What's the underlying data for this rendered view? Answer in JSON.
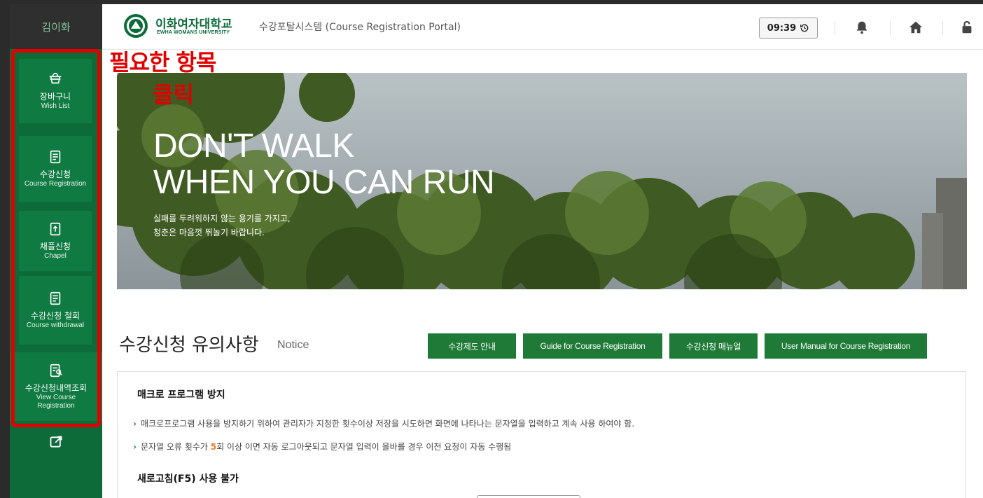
{
  "sidebar": {
    "user_name": "김이화",
    "items": [
      {
        "ko": "장바구니",
        "en": "Wish List",
        "icon": "basket-icon"
      },
      {
        "ko": "수강신청",
        "en": "Course Registration",
        "icon": "clipboard-icon"
      },
      {
        "ko": "채플신청",
        "en": "Chapel",
        "icon": "upload-doc-icon"
      },
      {
        "ko": "수강신청 철회",
        "en": "Course withdrawal",
        "icon": "clipboard-icon"
      },
      {
        "ko": "수강신청내역조회",
        "en": "View Course Registration",
        "icon": "search-doc-icon"
      }
    ],
    "external_icon": "external-link-icon"
  },
  "header": {
    "university_ko": "이화여자대학교",
    "university_en": "EWHA WOMANS UNIVERSITY",
    "portal_title": "수강포탈시스템 (Course Registration Portal)",
    "timer": "09:39",
    "icons": [
      "history-icon",
      "bell-icon",
      "home-icon",
      "lock-icon"
    ]
  },
  "annotation": {
    "line1": "필요한 항목",
    "line2": "클릭",
    "color": "#e00000"
  },
  "banner": {
    "headline_1": "DON'T WALK",
    "headline_2": "WHEN YOU CAN RUN",
    "subtext_1": "실패를 두려워하지 않는 용기를 가지고,",
    "subtext_2": "청춘은 마음껏 뛰놀기 바랍니다."
  },
  "notice": {
    "title": "수강신청 유의사항",
    "subtitle": "Notice",
    "buttons": [
      "수강제도 안내",
      "Guide for Course Registration",
      "수강신청 매뉴얼",
      "User Manual for Course Registration"
    ],
    "section_1_title": "매크로 프로그램 방지",
    "section_1_line_1": "매크로프로그램 사용을 방지하기 위하여 관리자가 지정한 횟수이상 저장을 시도하면 화면에 나타나는 문자열을 입력하고 계속 사용 하여야 함.",
    "section_1_line_2_pre": "문자열 오류 횟수가 ",
    "section_1_line_2_num": "5",
    "section_1_line_2_post": "회 이상 이면 자동 로그아웃되고 문자열 입력이 올바를 경우 이전 요청이 자동 수행됨",
    "section_2_title": "새로고침(F5) 사용 불가"
  },
  "colors": {
    "brand_green": "#0d6b3a",
    "button_green": "#1e7a36",
    "highlight_orange": "#f07a1a"
  }
}
